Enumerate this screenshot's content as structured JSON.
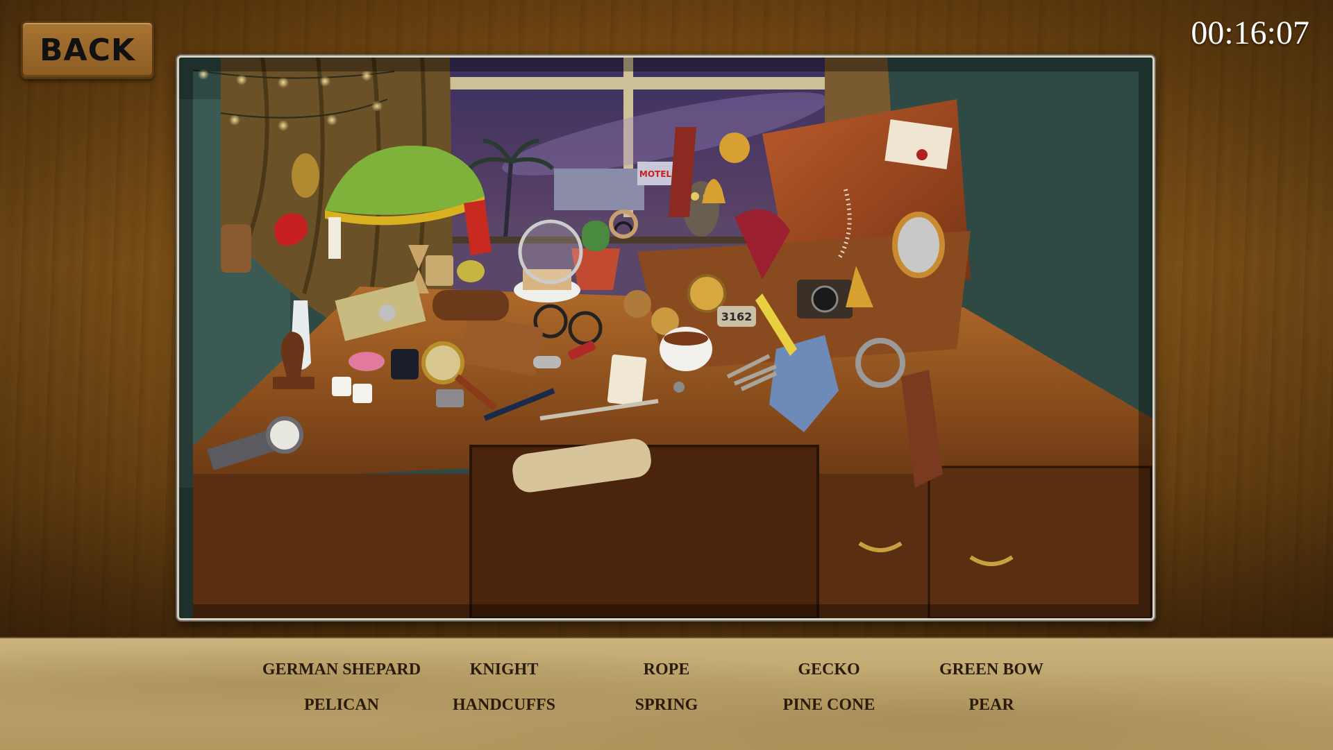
{
  "header": {
    "back_label": "BACK",
    "timer": "00:16:07"
  },
  "scene": {
    "motel_sign": "MOTEL",
    "tag_number": "3162",
    "colors": {
      "sky": "#2a2448",
      "desk": "#8a4e1e",
      "curtain": "#6a5128",
      "wall": "#2f4a44",
      "case": "#a34a22",
      "lampshade": "#7fb23a"
    }
  },
  "word_list": {
    "items": [
      "GERMAN SHEPARD",
      "KNIGHT",
      "ROPE",
      "GECKO",
      "GREEN BOW",
      "PELICAN",
      "HANDCUFFS",
      "SPRING",
      "PINE CONE",
      "PEAR"
    ]
  }
}
